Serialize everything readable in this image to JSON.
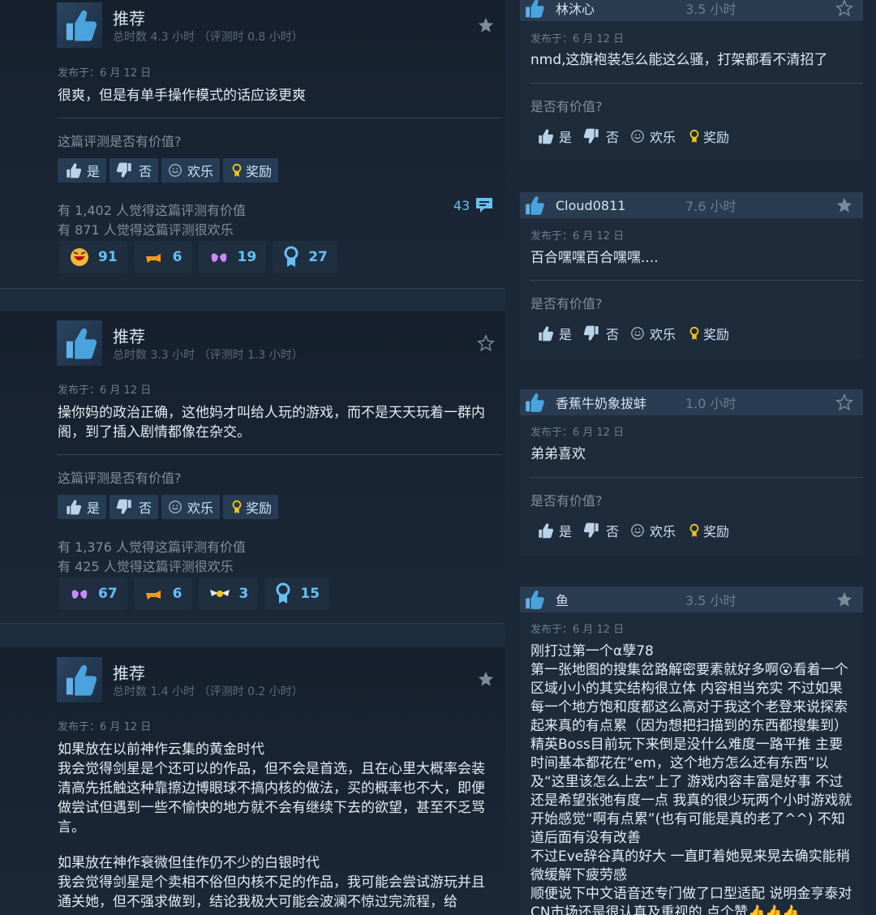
{
  "ui": {
    "helpful_question": "这篇评测是否有价值?",
    "yes": "是",
    "no": "否",
    "funny": "欢乐",
    "award": "奖励",
    "m_helpful_question": "是否有价值?"
  },
  "reviews": [
    {
      "title": "推荐",
      "hours": "总时数 4.3 小时 （评测时 0.8 小时）",
      "posted": "发布于：6 月 12 日",
      "text": "很爽，但是有单手操作模式的话应该更爽",
      "helpful_count": "有 1,402 人觉得这篇评测有价值",
      "funny_count": "有 871 人觉得这篇评测很欢乐",
      "comments": "43",
      "awards": [
        {
          "icon": "laugh-emoji-icon",
          "count": "91"
        },
        {
          "icon": "hand-icon",
          "count": "6"
        },
        {
          "icon": "heart-hands-icon",
          "count": "19"
        },
        {
          "icon": "ribbon-icon",
          "count": "27"
        }
      ]
    },
    {
      "title": "推荐",
      "hours": "总时数 3.3 小时 （评测时 1.3 小时）",
      "posted": "发布于：6 月 12 日",
      "text": "操你妈的政治正确，这他妈才叫给人玩的游戏，而不是天天玩着一群内阁，到了插入剧情都像在杂交。",
      "helpful_count": "有 1,376 人觉得这篇评测有价值",
      "funny_count": "有 425 人觉得这篇评测很欢乐",
      "awards": [
        {
          "icon": "heart-hands-icon",
          "count": "67"
        },
        {
          "icon": "hand-icon",
          "count": "6"
        },
        {
          "icon": "winged-icon",
          "count": "3"
        },
        {
          "icon": "ribbon-icon",
          "count": "15"
        }
      ]
    },
    {
      "title": "推荐",
      "hours": "总时数 1.4 小时 （评测时 0.2 小时）",
      "posted": "发布于：6 月 12 日",
      "para1": "如果放在以前神作云集的黄金时代\n我会觉得剑星是个还可以的作品，但不会是首选，且在心里大概率会装清高先抵触这种靠擦边博眼球不搞内核的做法，买的概率也不大，即便做尝试但遇到一些不愉快的地方就不会有继续下去的欲望，甚至不乏骂言。",
      "para2": "如果放在神作衰微但佳作仍不少的白银时代\n我会觉得剑星是个卖相不俗但内核不足的作品，我可能会尝试游玩并且通关她，但不强求做到，结论我极大可能会波澜不惊过完流程，给"
    }
  ],
  "mini_reviews": [
    {
      "name": "林沐心",
      "hours": "3.5 小时",
      "posted": "发布于：6 月 12 日",
      "text": "nmd,这旗袍装怎么能这么骚，打架都看不清招了"
    },
    {
      "name": "Cloud0811",
      "hours": "7.6 小时",
      "posted": "发布于：6 月 12 日",
      "text": "百合嘿嘿百合嘿嘿...."
    },
    {
      "name": "香蕉牛奶象拔蚌",
      "hours": "1.0 小时",
      "posted": "发布于：6 月 12 日",
      "text": "弟弟喜欢"
    },
    {
      "name": "鱼",
      "hours": "3.5 小时",
      "posted": "发布于：6 月 12 日",
      "text": "刚打过第一个α孽78\n第一张地图的搜集岔路解密要素就好多啊😮看着一个区域小小的其实结构很立体 内容相当充实 不过如果每一个地方饱和度都这么高对于我这个老登来说探索起来真的有点累（因为想把扫描到的东西都搜集到）精英Boss目前玩下来倒是没什么难度一路平推 主要时间基本都花在“em，这个地方怎么还有东西”以及“这里该怎么上去”上了 游戏内容丰富是好事 不过还是希望张弛有度一点 我真的很少玩两个小时游戏就开始感觉“啊有点累”(也有可能是真的老了^^) 不知道后面有没有改善\n不过Eve辞谷真的好大 一直盯着她晃来晃去确实能稍微缓解下疲劳感\n顺便说下中文语音还专门做了口型适配 说明金亨泰对CN市场还是很认真及重视的 点个赞👍👍👍"
    }
  ],
  "colors": {
    "bg": "#1b2838",
    "accent": "#66c0f4",
    "panel": "#2a3c52"
  }
}
